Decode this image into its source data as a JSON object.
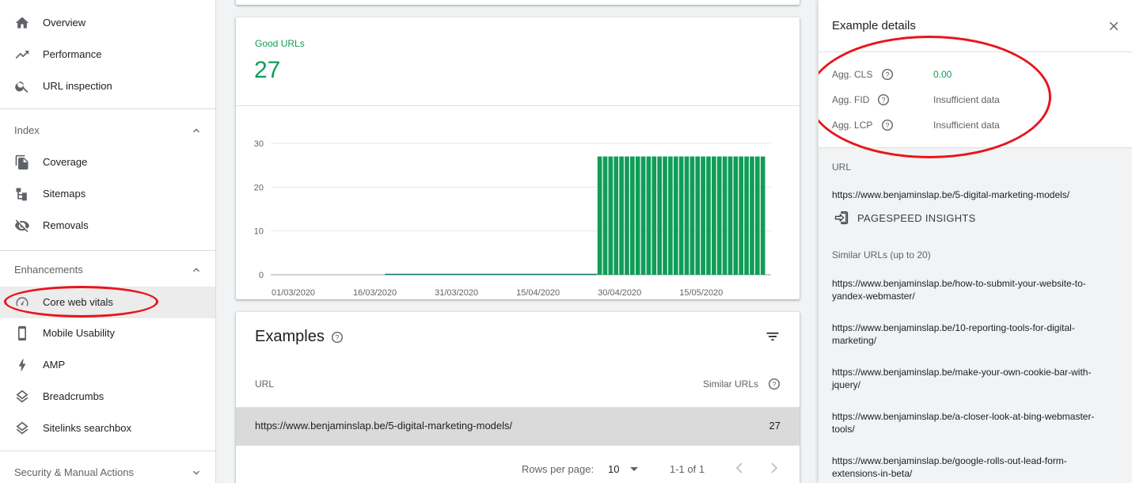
{
  "sidebar": {
    "top_items": [
      {
        "label": "Overview",
        "icon": "home-icon"
      },
      {
        "label": "Performance",
        "icon": "trending-up-icon"
      },
      {
        "label": "URL inspection",
        "icon": "search-icon"
      }
    ],
    "index": {
      "title": "Index",
      "items": [
        {
          "label": "Coverage",
          "icon": "file-copy-icon"
        },
        {
          "label": "Sitemaps",
          "icon": "sitemap-icon"
        },
        {
          "label": "Removals",
          "icon": "eye-off-icon"
        }
      ]
    },
    "enhancements": {
      "title": "Enhancements",
      "items": [
        {
          "label": "Core web vitals",
          "icon": "speedometer-icon",
          "active": true
        },
        {
          "label": "Mobile Usability",
          "icon": "phone-icon"
        },
        {
          "label": "AMP",
          "icon": "bolt-icon"
        },
        {
          "label": "Breadcrumbs",
          "icon": "layers-icon"
        },
        {
          "label": "Sitelinks searchbox",
          "icon": "layers-icon"
        }
      ]
    },
    "security": {
      "title": "Security & Manual Actions"
    }
  },
  "summary": {
    "label": "Good URLs",
    "value": "27",
    "color": "#0f9d58"
  },
  "chart_data": {
    "type": "bar",
    "x_tick_labels": [
      "01/03/2020",
      "16/03/2020",
      "31/03/2020",
      "15/04/2020",
      "30/04/2020",
      "15/05/2020"
    ],
    "y_ticks": [
      0,
      10,
      20,
      30
    ],
    "ylim": [
      0,
      30
    ],
    "x_start": "2020-03-01",
    "series": [
      {
        "color": "#0f9d58",
        "zero_from": "2020-03-22",
        "nonzero_from": "2020-04-30",
        "nonzero_to": "2020-05-30",
        "value": 27
      }
    ]
  },
  "examples": {
    "title": "Examples",
    "columns": {
      "url": "URL",
      "similar": "Similar URLs"
    },
    "rows": [
      {
        "url": "https://www.benjaminslap.be/5-digital-marketing-models/",
        "similar": "27"
      }
    ],
    "pagination": {
      "rows_per_page_label": "Rows per page:",
      "rows_per_page": "10",
      "range": "1-1 of 1"
    }
  },
  "details": {
    "title": "Example details",
    "metrics": [
      {
        "name": "Agg. CLS",
        "value": "0.00",
        "good": true
      },
      {
        "name": "Agg. FID",
        "value": "Insufficient data",
        "good": false
      },
      {
        "name": "Agg. LCP",
        "value": "Insufficient data",
        "good": false
      }
    ],
    "url_label": "URL",
    "url": "https://www.benjaminslap.be/5-digital-marketing-models/",
    "pagespeed_label": "PAGESPEED INSIGHTS",
    "similar_label": "Similar URLs (up to 20)",
    "similar_urls": [
      "https://www.benjaminslap.be/how-to-submit-your-website-to-yandex-webmaster/",
      "https://www.benjaminslap.be/10-reporting-tools-for-digital-marketing/",
      "https://www.benjaminslap.be/make-your-own-cookie-bar-with-jquery/",
      "https://www.benjaminslap.be/a-closer-look-at-bing-webmaster-tools/",
      "https://www.benjaminslap.be/google-rolls-out-lead-form-extensions-in-beta/"
    ]
  }
}
